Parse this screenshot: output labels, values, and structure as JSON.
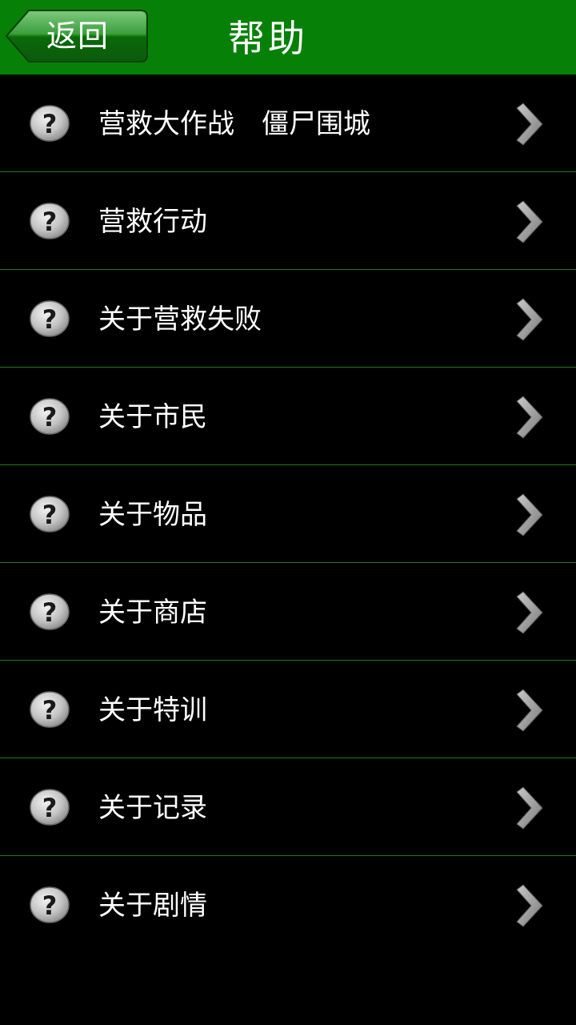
{
  "header": {
    "back_label": "返回",
    "title": "帮助",
    "background_color": "#078007"
  },
  "help_items": [
    {
      "label": "营救大作战　僵尸围城",
      "icon": "question-icon"
    },
    {
      "label": "营救行动",
      "icon": "question-icon"
    },
    {
      "label": "关于营救失败",
      "icon": "question-icon"
    },
    {
      "label": "关于市民",
      "icon": "question-icon"
    },
    {
      "label": "关于物品",
      "icon": "question-icon"
    },
    {
      "label": "关于商店",
      "icon": "question-icon"
    },
    {
      "label": "关于特训",
      "icon": "question-icon"
    },
    {
      "label": "关于记录",
      "icon": "question-icon"
    },
    {
      "label": "关于剧情",
      "icon": "question-icon"
    }
  ]
}
